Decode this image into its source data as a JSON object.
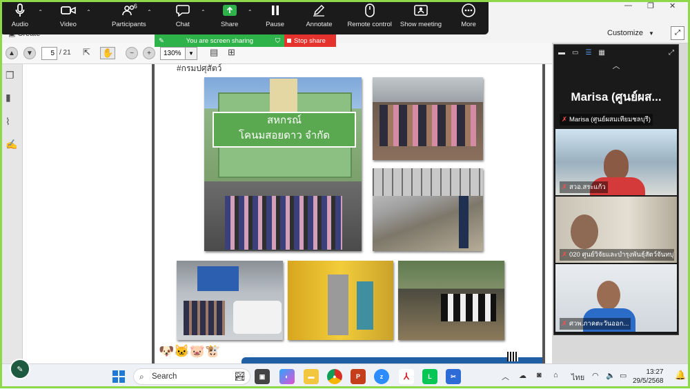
{
  "zoom_toolbar": {
    "items": [
      {
        "label": "Audio",
        "icon": "microphone-icon",
        "has_dropdown": true
      },
      {
        "label": "Video",
        "icon": "video-camera-icon",
        "has_dropdown": true
      },
      {
        "label": "Participants",
        "icon": "participants-icon",
        "has_dropdown": true,
        "count": "6"
      },
      {
        "label": "Chat",
        "icon": "chat-icon",
        "has_dropdown": true
      },
      {
        "label": "Share",
        "icon": "share-screen-icon",
        "has_dropdown": true
      },
      {
        "label": "Pause",
        "icon": "pause-icon"
      },
      {
        "label": "Annotate",
        "icon": "annotate-pen-icon"
      },
      {
        "label": "Remote control",
        "icon": "remote-control-icon"
      },
      {
        "label": "Show meeting",
        "icon": "show-meeting-icon"
      },
      {
        "label": "More",
        "icon": "more-icon"
      }
    ]
  },
  "sharing_banner": {
    "status": "You are screen sharing",
    "stop": "Stop share",
    "color": "#2eb34a",
    "stop_color": "#e5322d"
  },
  "app": {
    "customize": "Customize",
    "create": "Create"
  },
  "pdf_toolbar": {
    "page": "5",
    "total": "/ 21",
    "zoom": "130%"
  },
  "document": {
    "hashtag": "#กรมปศุสัตว์",
    "sign_line1": "สหกรณ์",
    "sign_line2": "โคนมสอยดาว จำกัด"
  },
  "gallery": {
    "active_speaker": "Marisa (ศูนย์ผส...",
    "participants": [
      {
        "name": "Marisa (ศูนย์ผสมเทียมชลบุรี)",
        "muted": true
      },
      {
        "name": "สวอ.สระแก้ว",
        "muted": true
      },
      {
        "name": "020 ศูนย์วิจัยและบำรุงพันธุ์สัตว์จันทบุรี",
        "muted": true
      },
      {
        "name": "ศวพ.ภาคตะวันออก...",
        "muted": true
      }
    ]
  },
  "taskbar": {
    "search_placeholder": "Search",
    "apps": [
      "start",
      "search",
      "task-view",
      "copilot",
      "file-explorer",
      "chrome",
      "powerpoint",
      "zoom",
      "acrobat",
      "line",
      "snipping-tool"
    ],
    "tray_lang": "ไทย",
    "time": "13:27",
    "date": "29/5/2568"
  }
}
